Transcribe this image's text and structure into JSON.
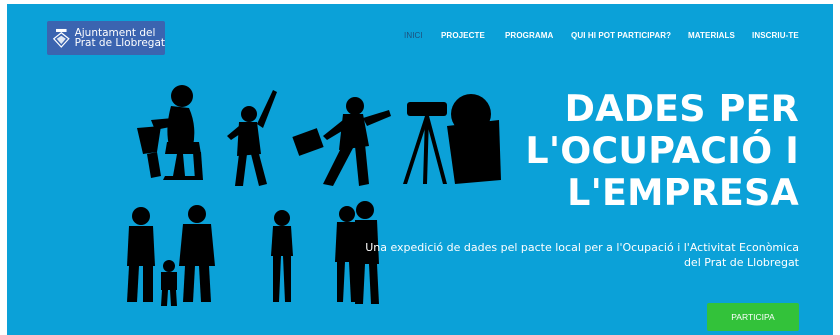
{
  "brand": {
    "line1": "Ajuntament del",
    "line2": "Prat de Llobregat"
  },
  "nav": {
    "items": [
      {
        "label": "INICI",
        "active": true
      },
      {
        "label": "PROJECTE",
        "active": false
      },
      {
        "label": "PROGRAMA",
        "active": false
      },
      {
        "label": "QUI HI POT PARTICIPAR?",
        "active": false
      },
      {
        "label": "MATERIALS",
        "active": false
      },
      {
        "label": "INSCRIU-TE",
        "active": false
      }
    ]
  },
  "hero": {
    "title_lines": [
      "DADES PER",
      "L'OCUPACIÓ I",
      "L'EMPRESA"
    ],
    "subtitle_line1": "Una expedició de dades pel pacte local per a l'Ocupació i l'Activitat Econòmica",
    "subtitle_line2": "del Prat de Llobregat",
    "cta_label": "PARTICIPA"
  },
  "colors": {
    "background": "#0ba1d8",
    "logo_bg": "#3b64b0",
    "cta": "#33c23a",
    "active_nav": "#1d4f7c"
  }
}
